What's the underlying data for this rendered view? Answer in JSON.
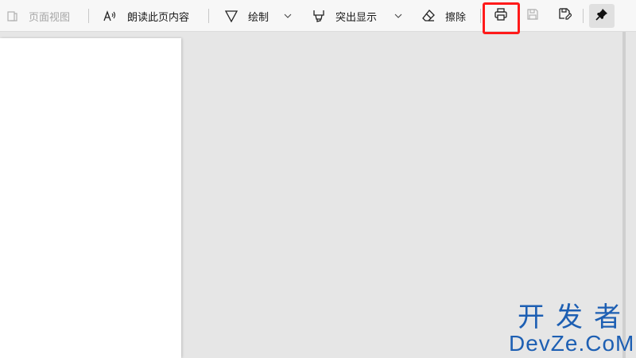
{
  "toolbar": {
    "page_view_label": "页面视图",
    "read_aloud_label": "朗读此页内容",
    "draw_label": "绘制",
    "highlight_label": "突出显示",
    "erase_label": "擦除"
  },
  "watermark": {
    "top_text": "开发者",
    "bottom_text": "DevZe.CoM"
  },
  "colors": {
    "highlight_box": "#ff1a1a",
    "watermark": "#1d5fb3",
    "canvas_bg": "#e6e6e6"
  },
  "icons": [
    "page-view-icon",
    "read-aloud-icon",
    "draw-icon",
    "highlight-icon",
    "eraser-icon",
    "print-icon",
    "save-icon",
    "save-as-icon",
    "pin-icon"
  ]
}
